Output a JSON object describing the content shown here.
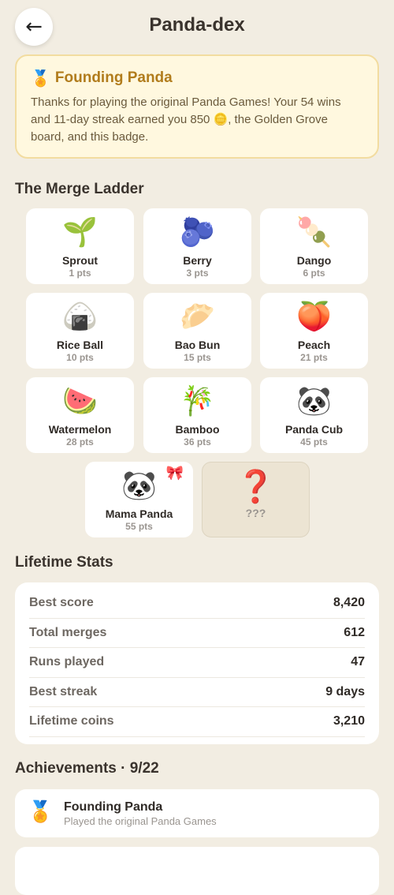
{
  "header": {
    "back_icon": "←",
    "title": "Panda-dex"
  },
  "founding": {
    "icon": "🏅",
    "title": "Founding Panda",
    "text": "Thanks for playing the original Panda Games! Your 54 wins and 11-day streak earned you 850 🪙, the Golden Grove board, and this badge."
  },
  "ladder": {
    "title": "The Merge Ladder",
    "items": [
      {
        "emoji": "🌱",
        "name": "Sprout",
        "pts": "1 pts"
      },
      {
        "emoji": "🫐",
        "name": "Berry",
        "pts": "3 pts"
      },
      {
        "emoji": "🍡",
        "name": "Dango",
        "pts": "6 pts"
      },
      {
        "emoji": "🍙",
        "name": "Rice Ball",
        "pts": "10 pts"
      },
      {
        "emoji": "🥟",
        "name": "Bao Bun",
        "pts": "15 pts"
      },
      {
        "emoji": "🍑",
        "name": "Peach",
        "pts": "21 pts"
      },
      {
        "emoji": "🍉",
        "name": "Watermelon",
        "pts": "28 pts"
      },
      {
        "emoji": "🎋",
        "name": "Bamboo",
        "pts": "36 pts"
      },
      {
        "emoji": "🐼",
        "name": "Panda Cub",
        "pts": "45 pts"
      },
      {
        "emoji": "🐼",
        "name": "Mama Panda",
        "pts": "55 pts",
        "badge": "🎀"
      },
      {
        "emoji": "❓",
        "name": "???"
      }
    ]
  },
  "stats": {
    "title": "Lifetime Stats",
    "rows": [
      {
        "label": "Best score",
        "value": "8,420"
      },
      {
        "label": "Total merges",
        "value": "612"
      },
      {
        "label": "Runs played",
        "value": "47"
      },
      {
        "label": "Best streak",
        "value": "9 days"
      },
      {
        "label": "Lifetime coins",
        "value": "3,210"
      }
    ]
  },
  "achievements": {
    "title": "Achievements · 9/22",
    "items": [
      {
        "icon": "🏅",
        "title": "Founding Panda",
        "desc": "Played the original Panda Games"
      }
    ]
  }
}
